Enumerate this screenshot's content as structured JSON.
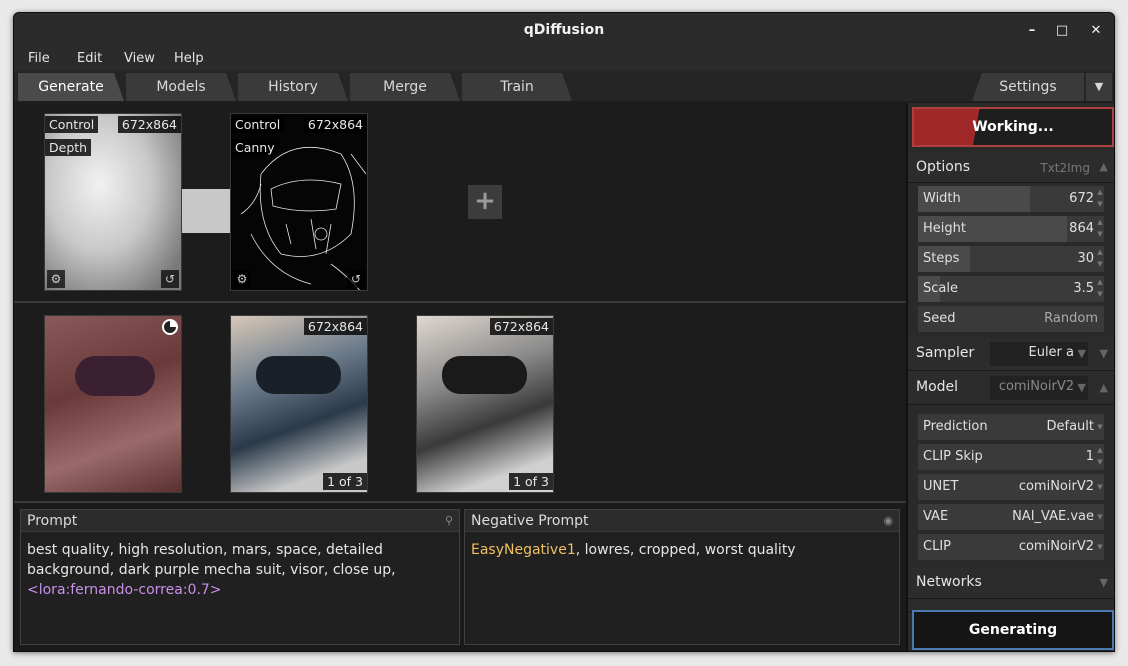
{
  "window": {
    "title": "qDiffusion"
  },
  "menu": [
    "File",
    "Edit",
    "View",
    "Help"
  ],
  "tabs": [
    "Generate",
    "Models",
    "History",
    "Merge",
    "Train"
  ],
  "settings_tab": "Settings",
  "controls": [
    {
      "label1": "Control",
      "label2": "Depth",
      "size": "672x864"
    },
    {
      "label1": "Control",
      "label2": "Canny",
      "size": "672x864"
    }
  ],
  "outputs": [
    {
      "size": "",
      "counter": ""
    },
    {
      "size": "672x864",
      "counter": "1 of 3"
    },
    {
      "size": "672x864",
      "counter": "1 of 3"
    }
  ],
  "prompt": {
    "title": "Prompt",
    "text_part1": "best quality, high resolution, mars, space, detailed background, dark purple mecha suit, visor, close up, ",
    "lora_open": "<lora:",
    "lora_name": "fernando-correa",
    "lora_colon": ":",
    "lora_weight": "0.7",
    "lora_close": ">"
  },
  "negative_prompt": {
    "title": "Negative Prompt",
    "embedding": "EasyNegative1",
    "text": ", lowres, cropped, worst quality"
  },
  "sidebar": {
    "working_label": "Working...",
    "options_title": "Options",
    "options_mode": "Txt2Img",
    "width_label": "Width",
    "width_value": "672",
    "height_label": "Height",
    "height_value": "864",
    "steps_label": "Steps",
    "steps_value": "30",
    "scale_label": "Scale",
    "scale_value": "3.5",
    "seed_label": "Seed",
    "seed_value": "Random",
    "sampler_title": "Sampler",
    "sampler_value": "Euler a",
    "model_title": "Model",
    "model_value": "comiNoirV2",
    "prediction_label": "Prediction",
    "prediction_value": "Default",
    "clipskip_label": "CLIP Skip",
    "clipskip_value": "1",
    "unet_label": "UNET",
    "unet_value": "comiNoirV2",
    "vae_label": "VAE",
    "vae_value": "NAI_VAE.vae",
    "clip_label": "CLIP",
    "clip_value": "comiNoirV2",
    "networks_title": "Networks",
    "generating_label": "Generating"
  },
  "colors": {
    "accent_red": "#b03030",
    "lora": "#c890e8",
    "embedding": "#f0c060",
    "generate_border": "#4a7ab0"
  }
}
